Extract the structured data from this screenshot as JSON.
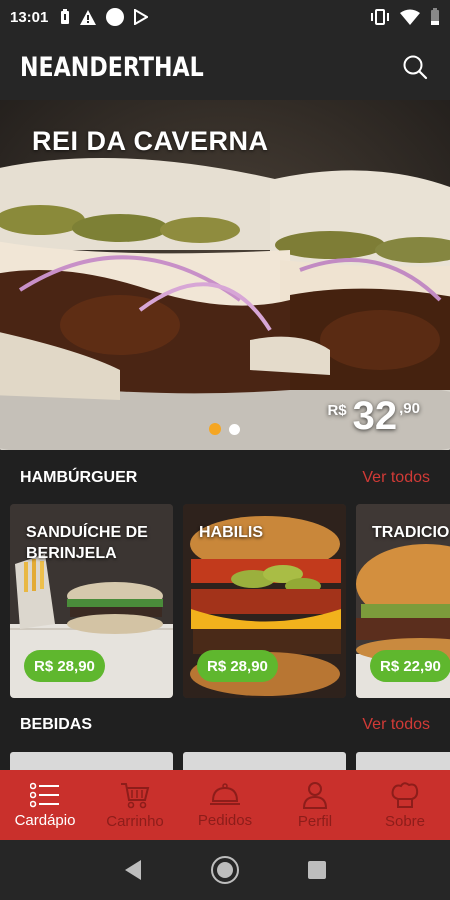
{
  "status_bar": {
    "time": "13:01"
  },
  "app_bar": {
    "brand": "NEANDERTHAL",
    "search_icon": "search-icon"
  },
  "hero": {
    "title": "REI DA CAVERNA",
    "price_currency": "R$",
    "price_int": "32",
    "price_dec": ",90",
    "slide_count": 2,
    "active_slide": 1
  },
  "sections": {
    "burgers": {
      "title": "HAMBÚRGUER",
      "see_all": "Ver todos"
    },
    "drinks": {
      "title": "BEBIDAS",
      "see_all": "Ver todos"
    }
  },
  "products": [
    {
      "name": "SANDUÍCHE DE BERINJELA",
      "price": "R$ 28,90"
    },
    {
      "name": "HABILIS",
      "price": "R$ 28,90"
    },
    {
      "name": "TRADICIO",
      "price": "R$ 22,90"
    }
  ],
  "bottom_nav": [
    {
      "label": "Cardápio",
      "icon": "menu-list-icon",
      "active": true
    },
    {
      "label": "Carrinho",
      "icon": "cart-icon",
      "active": false
    },
    {
      "label": "Pedidos",
      "icon": "cloche-icon",
      "active": false
    },
    {
      "label": "Perfil",
      "icon": "person-icon",
      "active": false
    },
    {
      "label": "Sobre",
      "icon": "chef-hat-icon",
      "active": false
    }
  ],
  "colors": {
    "accent_red": "#c9302c",
    "see_all_red": "#d13a36",
    "price_green": "#5fb72e",
    "dot_active": "#f5a623",
    "dark_bg": "#202020"
  }
}
